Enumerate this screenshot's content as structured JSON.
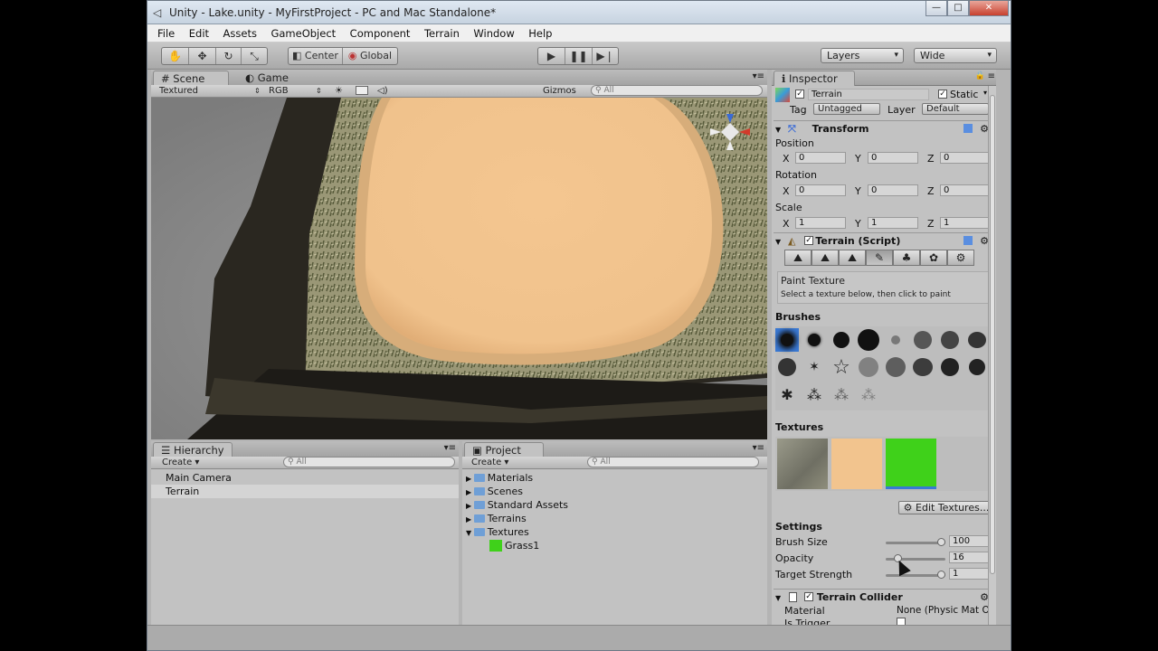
{
  "window": {
    "title": "Unity - Lake.unity - MyFirstProject - PC and Mac Standalone*",
    "minimize": "—",
    "maximize": "□",
    "close": "✕"
  },
  "menu": [
    "File",
    "Edit",
    "Assets",
    "GameObject",
    "Component",
    "Terrain",
    "Window",
    "Help"
  ],
  "toolbar": {
    "pivot_label": "Center",
    "space_label": "Global",
    "layers_label": "Layers",
    "layout_label": "Wide"
  },
  "scene": {
    "tab_scene": "Scene",
    "tab_game": "Game",
    "render_mode": "Textured",
    "color_mode": "RGB",
    "gizmos": "Gizmos",
    "search_placeholder": "All"
  },
  "hierarchy": {
    "tab": "Hierarchy",
    "create": "Create",
    "search_placeholder": "All",
    "items": [
      "Main Camera",
      "Terrain"
    ],
    "selected": "Terrain"
  },
  "project": {
    "tab": "Project",
    "create": "Create",
    "search_placeholder": "All",
    "items": [
      {
        "label": "Materials",
        "type": "folder",
        "expanded": false
      },
      {
        "label": "Scenes",
        "type": "folder",
        "expanded": false
      },
      {
        "label": "Standard Assets",
        "type": "folder",
        "expanded": false
      },
      {
        "label": "Terrains",
        "type": "folder",
        "expanded": false
      },
      {
        "label": "Textures",
        "type": "folder",
        "expanded": true
      },
      {
        "label": "Grass1",
        "type": "texture",
        "expanded": false
      }
    ]
  },
  "inspector": {
    "tab": "Inspector",
    "object_name": "Terrain",
    "static_label": "Static",
    "tag_label": "Tag",
    "tag_value": "Untagged",
    "layer_label": "Layer",
    "layer_value": "Default",
    "transform": {
      "title": "Transform",
      "position_label": "Position",
      "rotation_label": "Rotation",
      "scale_label": "Scale",
      "position": {
        "x": "0",
        "y": "0",
        "z": "0"
      },
      "rotation": {
        "x": "0",
        "y": "0",
        "z": "0"
      },
      "scale": {
        "x": "1",
        "y": "1",
        "z": "1"
      },
      "axis_x": "X",
      "axis_y": "Y",
      "axis_z": "Z"
    },
    "terrain_script": {
      "title": "Terrain (Script)",
      "tool_title": "Paint Texture",
      "tool_hint": "Select a texture below, then click to paint",
      "brushes_label": "Brushes",
      "textures_label": "Textures",
      "edit_textures": "Edit Textures...",
      "settings_label": "Settings",
      "brush_size_label": "Brush Size",
      "brush_size": "100",
      "brush_size_level": 1.0,
      "opacity_label": "Opacity",
      "opacity": "16",
      "opacity_level": 0.16,
      "target_strength_label": "Target Strength",
      "target_strength": "1",
      "target_strength_level": 1.0
    },
    "collider": {
      "title": "Terrain Collider",
      "material_label": "Material",
      "material_value": "None (Physic Mat O",
      "is_trigger_label": "Is Trigger"
    }
  },
  "colors": {
    "sand": "#f2c48e",
    "grass_texture": "#3fd11a",
    "selection": "#3a79d4"
  }
}
